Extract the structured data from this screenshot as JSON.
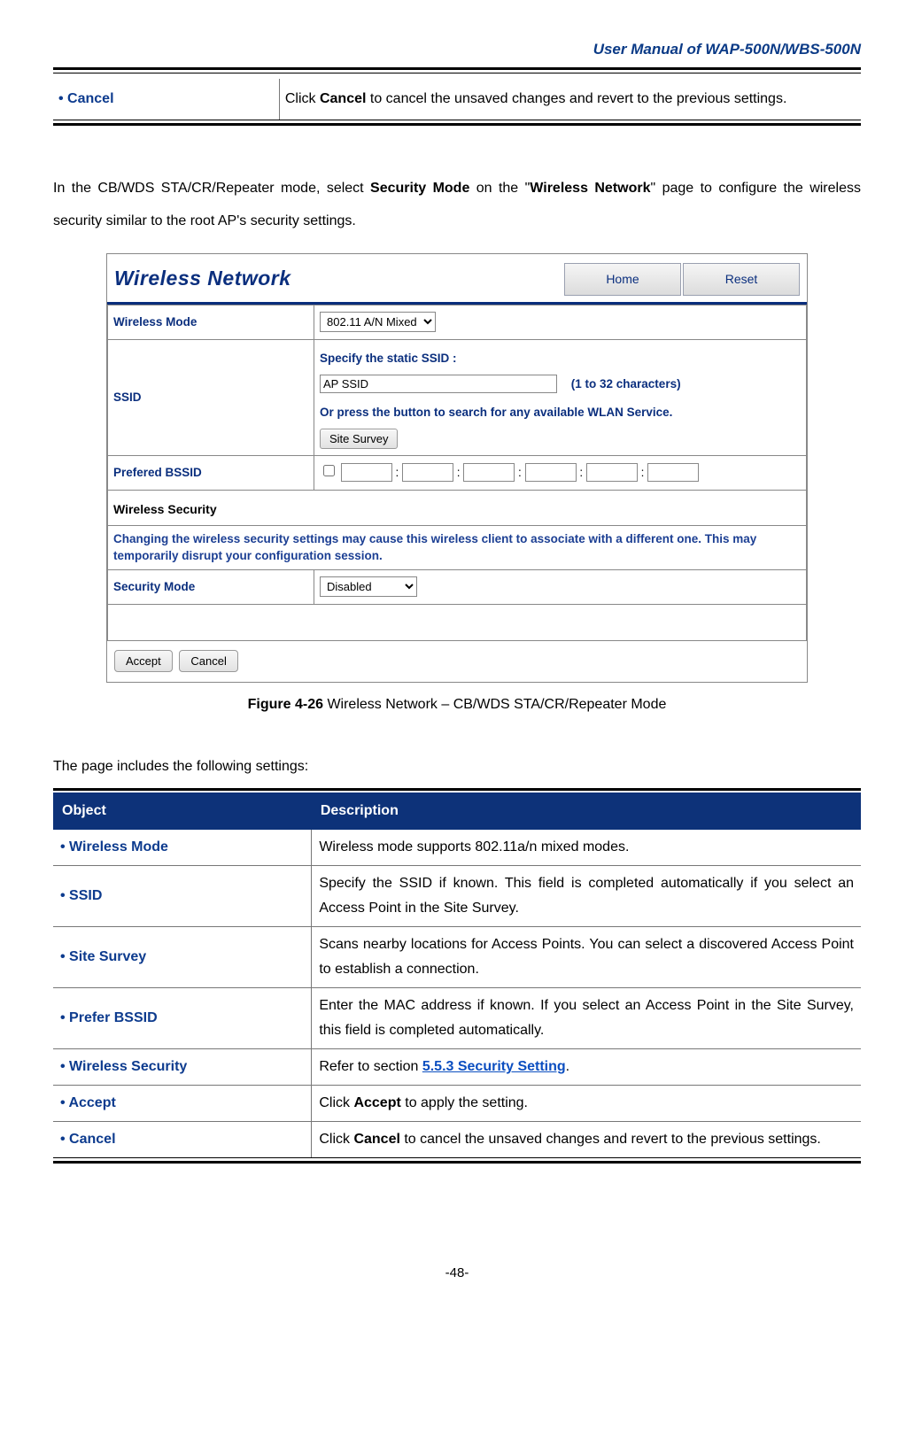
{
  "header": {
    "title": "User Manual of WAP-500N/WBS-500N"
  },
  "top_cancel": {
    "label": "Cancel",
    "desc_prefix": "Click ",
    "desc_bold": "Cancel",
    "desc_suffix": " to cancel the unsaved changes and revert to the previous settings."
  },
  "para": {
    "p1_a": "In the CB/WDS STA/CR/Repeater mode, select ",
    "p1_bold1": "Security Mode",
    "p1_b": " on the \"",
    "p1_bold2": "Wireless Network",
    "p1_c": "\" page to configure the wireless security similar to the root AP's security settings."
  },
  "screenshot": {
    "title": "Wireless Network",
    "home": "Home",
    "reset": "Reset",
    "wireless_mode_label": "Wireless Mode",
    "wireless_mode_value": "802.11 A/N Mixed",
    "ssid_label": "SSID",
    "ssid_line1": "Specify the static SSID :",
    "ssid_value": "AP SSID",
    "ssid_chars": "(1 to 32 characters)",
    "ssid_line2": "Or press the button to search for any available WLAN Service.",
    "site_survey": "Site Survey",
    "pref_bssid_label": "Prefered BSSID",
    "sec_title": "Wireless Security",
    "sec_note": "Changing the wireless security settings may cause this wireless client to associate with a different one. This may temporarily disrupt your configuration session.",
    "sec_mode_label": "Security Mode",
    "sec_mode_value": "Disabled",
    "accept": "Accept",
    "cancel": "Cancel"
  },
  "caption": {
    "fig": "Figure 4-26",
    "text": " Wireless Network – CB/WDS STA/CR/Repeater Mode"
  },
  "settings_intro": "The page includes the following settings:",
  "table": {
    "h1": "Object",
    "h2": "Description",
    "rows": [
      {
        "obj": "Wireless Mode",
        "desc": "Wireless mode supports 802.11a/n mixed modes."
      },
      {
        "obj": "SSID",
        "desc": "Specify the SSID if known. This field is completed automatically if you select an Access Point in the Site Survey."
      },
      {
        "obj": "Site Survey",
        "desc": "Scans nearby locations for Access Points. You can select a discovered Access Point to establish a connection."
      },
      {
        "obj": "Prefer BSSID",
        "desc": "Enter the MAC address if known. If you select an Access Point in the Site Survey, this field is completed automatically."
      },
      {
        "obj": "Wireless Security",
        "desc_prefix": "Refer to section ",
        "link": "5.5.3 Security Setting",
        "desc_suffix": "."
      },
      {
        "obj": "Accept",
        "desc_prefix": "Click ",
        "bold": "Accept",
        "desc_suffix": " to apply the setting."
      },
      {
        "obj": "Cancel",
        "desc_prefix": "Click ",
        "bold": "Cancel",
        "desc_suffix": " to cancel the unsaved changes and revert to the previous settings."
      }
    ]
  },
  "page_num": "-48-"
}
